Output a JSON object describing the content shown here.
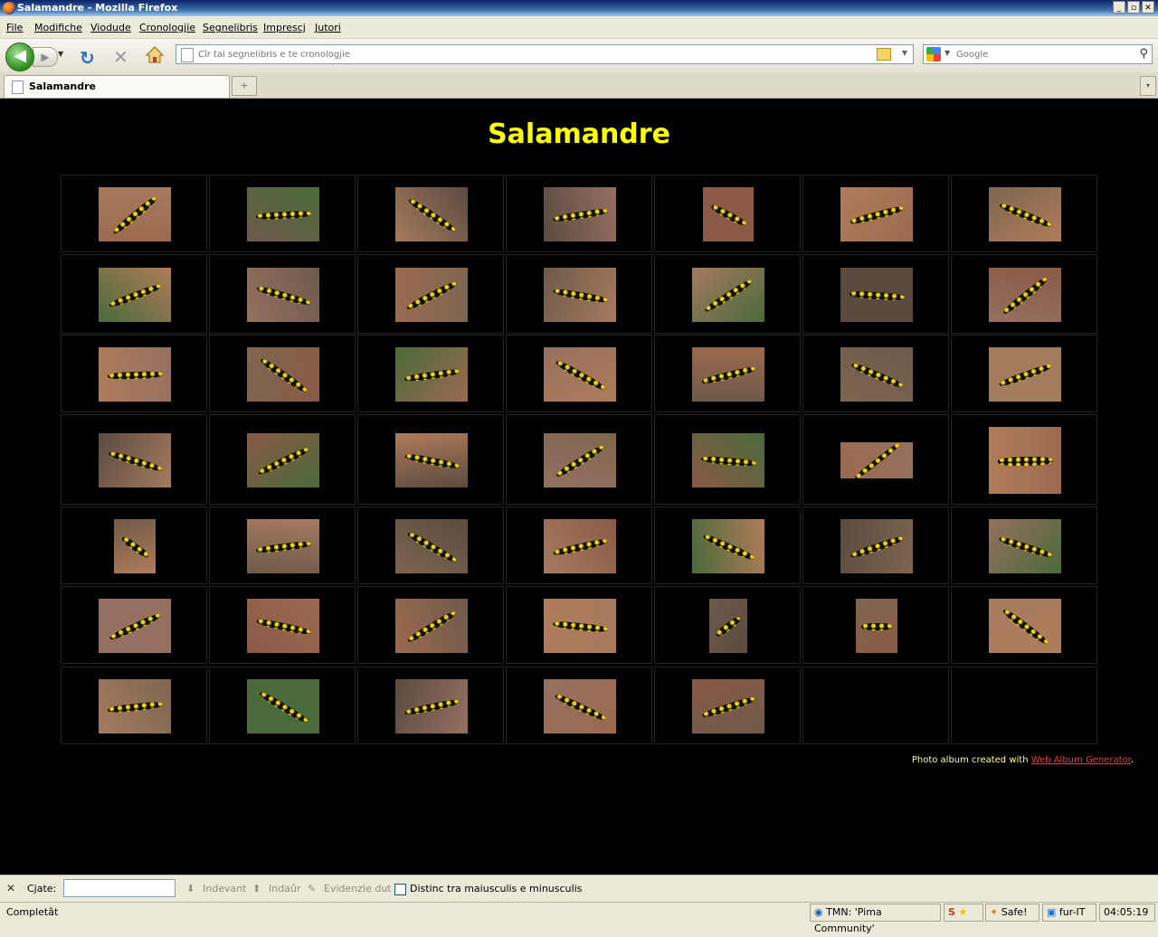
{
  "window": {
    "title": "Salamandre - Mozilla Firefox",
    "controls": [
      "_",
      "▫",
      "✕"
    ]
  },
  "menu": [
    "File",
    "Modifiche",
    "Viodude",
    "Cronologjie",
    "Segnelibris",
    "Imprescj",
    "Jutori"
  ],
  "nav": {
    "url_placeholder": "Cîr tai segnelibris e te cronologjie",
    "search_placeholder": "Google"
  },
  "tab": {
    "label": "Salamandre",
    "new_tab": "+",
    "list": "▾"
  },
  "page": {
    "title": "Salamandre",
    "credit_prefix": "Photo album created with ",
    "credit_link": "Web Album Generator",
    "credit_suffix": "."
  },
  "findbar": {
    "close": "✕",
    "label": "Cjate:",
    "next": "Indevant",
    "prev": "Indaûr",
    "highlight": "Evidenzie dut",
    "match_case": "Distinc tra maiusculis e minusculis"
  },
  "status": {
    "text": "Completât",
    "tmn": "TMN: 'Pima Community'",
    "safe": "Safe!",
    "locale": "fur-IT",
    "clock": "04:05:19"
  },
  "accent": {
    "title_yellow": "#ffff00",
    "link_red": "#ff3333"
  },
  "gallery": {
    "rows": 7,
    "cols": 7,
    "photo_count": 47
  }
}
